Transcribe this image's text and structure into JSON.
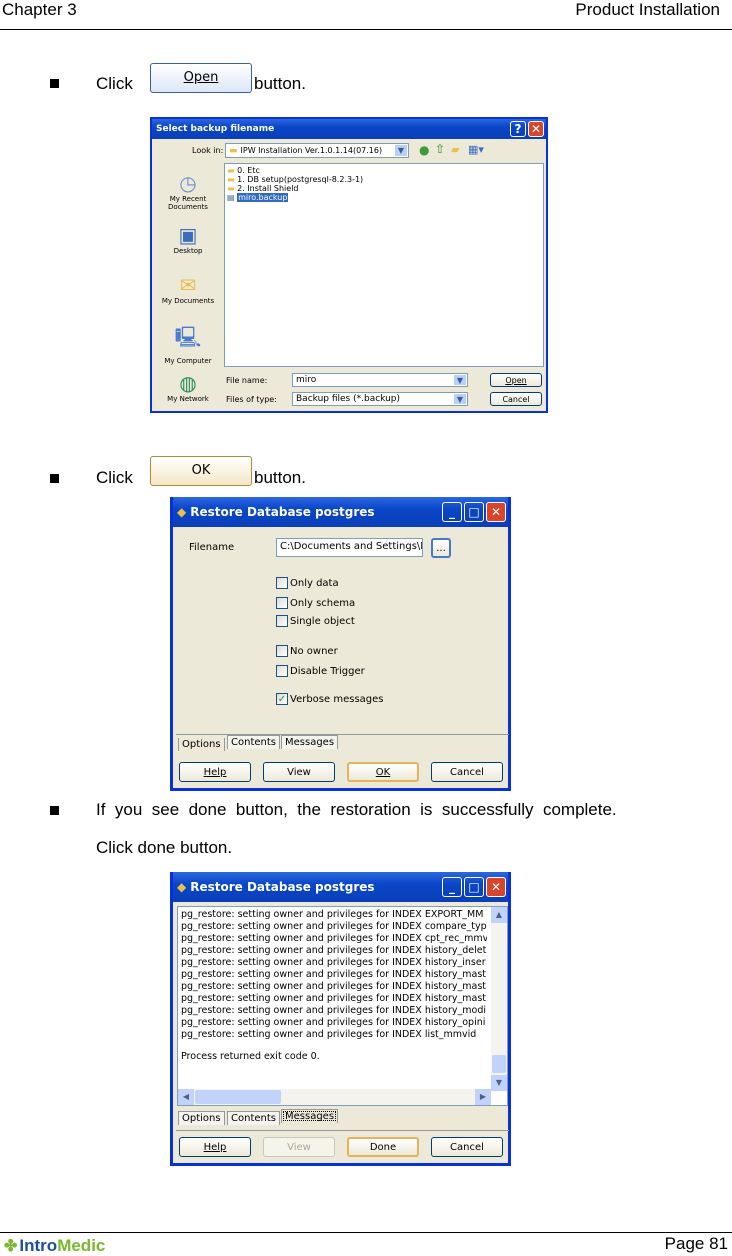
{
  "header": {
    "chapter": "Chapter 3",
    "section": "Product Installation"
  },
  "steps": [
    {
      "prefix": "Click",
      "button_label": "Open",
      "suffix": "button."
    },
    {
      "prefix": "Click",
      "button_label": "OK",
      "suffix": "button."
    },
    {
      "text_line1": "If  you  see  done  button,  the  restoration  is  successfully  complete.",
      "text_line2": "Click done button."
    }
  ],
  "open_dialog": {
    "title": "Select backup filename",
    "look_in_label": "Look in:",
    "look_in_value": "IPW Installation Ver.1.0.1.14(07.16)",
    "places": [
      "My Recent Documents",
      "Desktop",
      "My Documents",
      "My Computer",
      "My Network"
    ],
    "files": [
      {
        "name": "0. Etc",
        "type": "folder",
        "selected": false
      },
      {
        "name": "1. DB setup(postgresql-8.2.3-1)",
        "type": "folder",
        "selected": false
      },
      {
        "name": "2. Install Shield",
        "type": "folder",
        "selected": false
      },
      {
        "name": "miro.backup",
        "type": "file",
        "selected": true
      }
    ],
    "file_name_label": "File name:",
    "file_name_value": "miro",
    "file_type_label": "Files of type:",
    "file_type_value": "Backup files (*.backup)",
    "open_button": "Open",
    "cancel_button": "Cancel"
  },
  "restore_dialog_1": {
    "title": "Restore Database postgres",
    "filename_label": "Filename",
    "filename_value": "C:\\Documents and Settings\\M",
    "browse_button": "...",
    "options": [
      {
        "label": "Only data",
        "checked": false
      },
      {
        "label": "Only schema",
        "checked": false
      },
      {
        "label": "Single object",
        "checked": false
      },
      {
        "label": "No owner",
        "checked": false
      },
      {
        "label": "Disable Trigger",
        "checked": false
      },
      {
        "label": "Verbose messages",
        "checked": true
      }
    ],
    "tabs": [
      "Options",
      "Contents",
      "Messages"
    ],
    "active_tab": "Options",
    "buttons": [
      "Help",
      "View",
      "OK",
      "Cancel"
    ]
  },
  "restore_dialog_2": {
    "title": "Restore Database postgres",
    "log_lines": [
      "pg_restore: setting owner and privileges for INDEX EXPORT_MM",
      "pg_restore: setting owner and privileges for INDEX compare_typ",
      "pg_restore: setting owner and privileges for INDEX cpt_rec_mmv",
      "pg_restore: setting owner and privileges for INDEX history_delet",
      "pg_restore: setting owner and privileges for INDEX history_inser",
      "pg_restore: setting owner and privileges for INDEX history_mast",
      "pg_restore: setting owner and privileges for INDEX history_mast",
      "pg_restore: setting owner and privileges for INDEX history_mast",
      "pg_restore: setting owner and privileges for INDEX history_modi",
      "pg_restore: setting owner and privileges for INDEX history_opini",
      "pg_restore: setting owner and privileges for INDEX list_mmvid"
    ],
    "exit_line": "Process returned exit code 0.",
    "tabs": [
      "Options",
      "Contents",
      "Messages"
    ],
    "active_tab": "Messages",
    "buttons": [
      "Help",
      "View",
      "Done",
      "Cancel"
    ]
  },
  "footer": {
    "logo_text": "IntroMedic",
    "page": "Page 81"
  },
  "colors": {
    "xp_blue": "#0a46c8",
    "dialog_bg": "#ece9d8",
    "logo_blue": "#1c4fa0",
    "logo_green": "#7ab82e"
  }
}
